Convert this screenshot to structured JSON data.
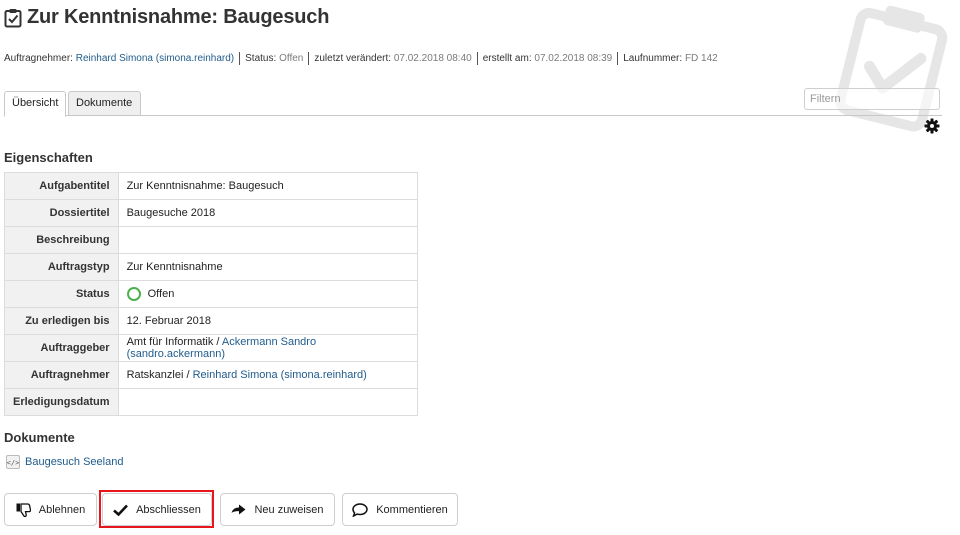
{
  "header": {
    "title": "Zur Kenntnisnahme: Baugesuch",
    "title_icon": "clipboard-check-icon",
    "watermark_icon": "clipboard-check-watermark-icon"
  },
  "byline": {
    "assignee_label": "Auftragnehmer:",
    "assignee_value": "Reinhard Simona (simona.reinhard)",
    "status_label": "Status:",
    "status_value": "Offen",
    "modified_label": "zuletzt verändert:",
    "modified_value": "07.02.2018 08:40",
    "created_label": "erstellt am:",
    "created_value": "07.02.2018 08:39",
    "seq_label": "Laufnummer:",
    "seq_value": "FD 142"
  },
  "tabs": [
    {
      "label": "Übersicht",
      "active": true
    },
    {
      "label": "Dokumente",
      "active": false
    }
  ],
  "filter": {
    "placeholder": "Filtern",
    "value": ""
  },
  "properties": {
    "heading": "Eigenschaften",
    "rows": [
      {
        "label": "Aufgabentitel",
        "value": "Zur Kenntnisnahme: Baugesuch"
      },
      {
        "label": "Dossiertitel",
        "value": "Baugesuche 2018"
      },
      {
        "label": "Beschreibung",
        "value": ""
      },
      {
        "label": "Auftragstyp",
        "value": "Zur Kenntnisnahme"
      },
      {
        "label": "Status",
        "value": "Offen",
        "status_color": "#4cb04c"
      },
      {
        "label": "Zu erledigen bis",
        "value": "12. Februar 2018"
      },
      {
        "label": "Auftraggeber",
        "prefix": "Amt für Informatik / ",
        "link": "Ackermann Sandro (sandro.ackermann)"
      },
      {
        "label": "Auftragnehmer",
        "prefix": "Ratskanzlei / ",
        "link": "Reinhard Simona (simona.reinhard)"
      },
      {
        "label": "Erledigungsdatum",
        "value": ""
      }
    ]
  },
  "documents": {
    "heading": "Dokumente",
    "items": [
      {
        "label": "Baugesuch Seeland",
        "icon": "xml-file-icon"
      }
    ]
  },
  "actions": {
    "reject": "Ablehnen",
    "close": "Abschliessen",
    "reassign": "Neu zuweisen",
    "comment": "Kommentieren"
  },
  "colors": {
    "link": "#205c8c",
    "highlight": "#e8151b",
    "status_open": "#4cb04c",
    "label_bg": "#f1f1f1"
  }
}
